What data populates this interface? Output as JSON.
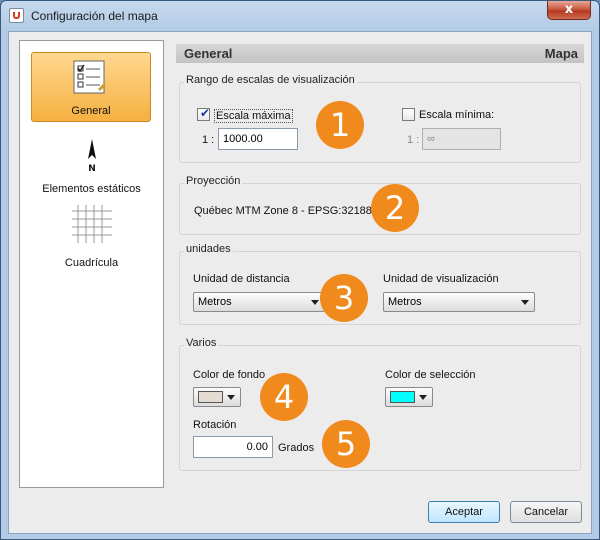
{
  "window": {
    "title": "Configuración del mapa",
    "close_label": "x"
  },
  "sidebar": {
    "items": [
      {
        "label": "General",
        "icon": "checklist-icon",
        "selected": true
      },
      {
        "label": "Elementos estáticos",
        "icon": "north-arrow-icon",
        "icon_text": "N"
      },
      {
        "label": "Cuadrícula",
        "icon": "grid-icon"
      }
    ]
  },
  "header": {
    "left": "General",
    "right": "Mapa"
  },
  "scale_range": {
    "title": "Rango de escalas de visualización",
    "max": {
      "label": "Escala máxima",
      "checked": true,
      "prefix": "1 :",
      "value": "1000.00"
    },
    "min": {
      "label": "Escala mínima:",
      "checked": false,
      "prefix": "1 :",
      "value": "∞"
    }
  },
  "projection": {
    "title": "Proyección",
    "value": "Québec MTM Zone 8 - EPSG:32188"
  },
  "units": {
    "title": "unidades",
    "distance": {
      "label": "Unidad de distancia",
      "selected": "Metros"
    },
    "display": {
      "label": "Unidad de visualización",
      "selected": "Metros"
    }
  },
  "misc": {
    "title": "Varios",
    "background_color": {
      "label": "Color de fondo",
      "color": "#e4dcd2"
    },
    "selection_color": {
      "label": "Color de selección",
      "color": "#00ffff"
    },
    "rotation": {
      "label": "Rotación",
      "value": "0.00",
      "unit": "Grados"
    }
  },
  "callouts": [
    "1",
    "2",
    "3",
    "4",
    "5"
  ],
  "buttons": {
    "accept": "Aceptar",
    "cancel": "Cancelar"
  },
  "colors": {
    "accent": "#f08a1c",
    "selected_bg": "#f5b040"
  }
}
